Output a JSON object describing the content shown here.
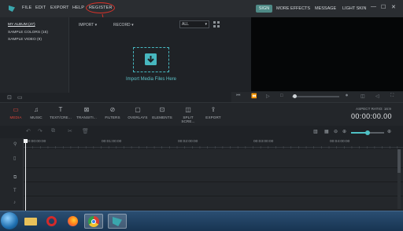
{
  "menubar": {
    "items": [
      "FILE",
      "EDIT",
      "EXPORT",
      "HELP",
      "REGISTER"
    ],
    "right_items": [
      "SIGN",
      "MORE EFFECTS",
      "MESSAGE",
      "LIGHT SKIN"
    ],
    "window_controls": [
      "—",
      "☐",
      "✕"
    ],
    "annotation_color": "#d8322a"
  },
  "library": {
    "items": [
      "MY ALBUM (47)",
      "SAMPLE COLORS (15)",
      "SAMPLE VIDEO (9)"
    ]
  },
  "media": {
    "import_dropdown": "IMPORT",
    "record_dropdown": "RECORD",
    "filter_value": "ALL",
    "import_label": "Import Media Files Here",
    "accent_color": "#47b7bf"
  },
  "toolbar": {
    "tools": [
      {
        "label": "MEDIA",
        "icon": "folder-icon"
      },
      {
        "label": "MUSIC",
        "icon": "music-icon"
      },
      {
        "label": "TEXT/CRE...",
        "icon": "text-icon"
      },
      {
        "label": "TRANSITI...",
        "icon": "transition-icon"
      },
      {
        "label": "FILTERS",
        "icon": "filter-icon"
      },
      {
        "label": "OVERLAYS",
        "icon": "overlay-icon"
      },
      {
        "label": "ELEMENTS",
        "icon": "image-icon"
      },
      {
        "label": "SPLIT SCRE...",
        "icon": "split-screen-icon"
      },
      {
        "label": "EXPORT",
        "icon": "export-icon"
      }
    ],
    "active_color": "#e2473b",
    "aspect_ratio": "ASPECT RATIO: 16:9",
    "timecode": "00:00:00.00"
  },
  "timeline": {
    "ruler_labels": [
      "00:00:00:00",
      "00:01:00:00",
      "00:02:00:00",
      "00:03:00:00",
      "00:04:00:00"
    ]
  }
}
